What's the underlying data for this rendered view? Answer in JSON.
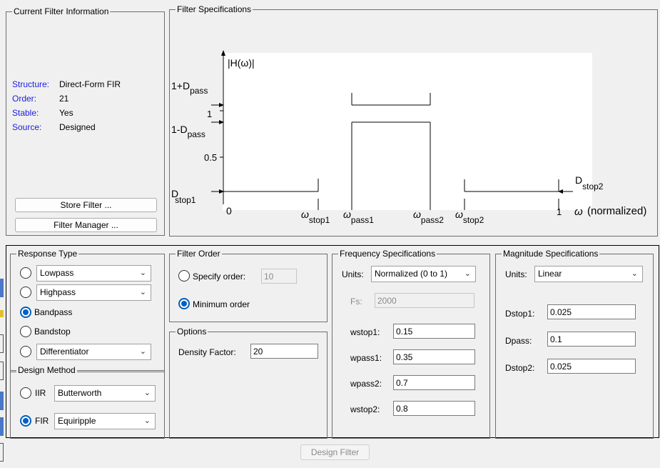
{
  "current_filter": {
    "title": "Current Filter Information",
    "rows": [
      {
        "label": "Structure:",
        "value": "Direct-Form FIR"
      },
      {
        "label": "Order:",
        "value": "21"
      },
      {
        "label": "Stable:",
        "value": "Yes"
      },
      {
        "label": "Source:",
        "value": "Designed"
      }
    ],
    "store_button": "Store Filter ...",
    "manager_button": "Filter Manager ..."
  },
  "filter_specs": {
    "title": "Filter Specifications",
    "hlabel": "|H(ω)|",
    "y_1pd_main": "1+D",
    "y_1pd_sub": "pass",
    "y_one": "1",
    "y_1md_main": "1-D",
    "y_1md_sub": "pass",
    "y_half": "0.5",
    "dstop1_main": "D",
    "dstop1_sub": "stop1",
    "dstop2_main": "D",
    "dstop2_sub": "stop2",
    "x_zero": "0",
    "x_one": "1",
    "omega": "ω",
    "w_stop1_sub": "stop1",
    "w_pass1_sub": "pass1",
    "w_pass2_sub": "pass2",
    "w_stop2_sub": "stop2",
    "x_unit": "(normalized)"
  },
  "response_type": {
    "title": "Response Type",
    "lowpass": "Lowpass",
    "highpass": "Highpass",
    "bandpass": "Bandpass",
    "bandstop": "Bandstop",
    "differentiator": "Differentiator",
    "selected": "Bandpass"
  },
  "design_method": {
    "title": "Design Method",
    "iir_label": "IIR",
    "iir_value": "Butterworth",
    "fir_label": "FIR",
    "fir_value": "Equiripple",
    "selected": "FIR"
  },
  "filter_order": {
    "title": "Filter Order",
    "specify_label": "Specify order:",
    "specify_value": "10",
    "minimum_label": "Minimum order",
    "selected": "Minimum order"
  },
  "options": {
    "title": "Options",
    "density_label": "Density Factor:",
    "density_value": "20"
  },
  "freq_specs": {
    "title": "Frequency Specifications",
    "units_label": "Units:",
    "units_value": "Normalized (0 to 1)",
    "fs_label": "Fs:",
    "fs_value": "2000",
    "wstop1_label": "wstop1:",
    "wstop1_value": "0.15",
    "wpass1_label": "wpass1:",
    "wpass1_value": "0.35",
    "wpass2_label": "wpass2:",
    "wpass2_value": "0.7",
    "wstop2_label": "wstop2:",
    "wstop2_value": "0.8"
  },
  "mag_specs": {
    "title": "Magnitude Specifications",
    "units_label": "Units:",
    "units_value": "Linear",
    "dstop1_label": "Dstop1:",
    "dstop1_value": "0.025",
    "dpass_label": "Dpass:",
    "dpass_value": "0.1",
    "dstop2_label": "Dstop2:",
    "dstop2_value": "0.025"
  },
  "design_button": "Design Filter",
  "colors": {
    "accent": "#0060c0",
    "label_blue": "#1c1ce0",
    "disabled": "#8a8a8a"
  }
}
